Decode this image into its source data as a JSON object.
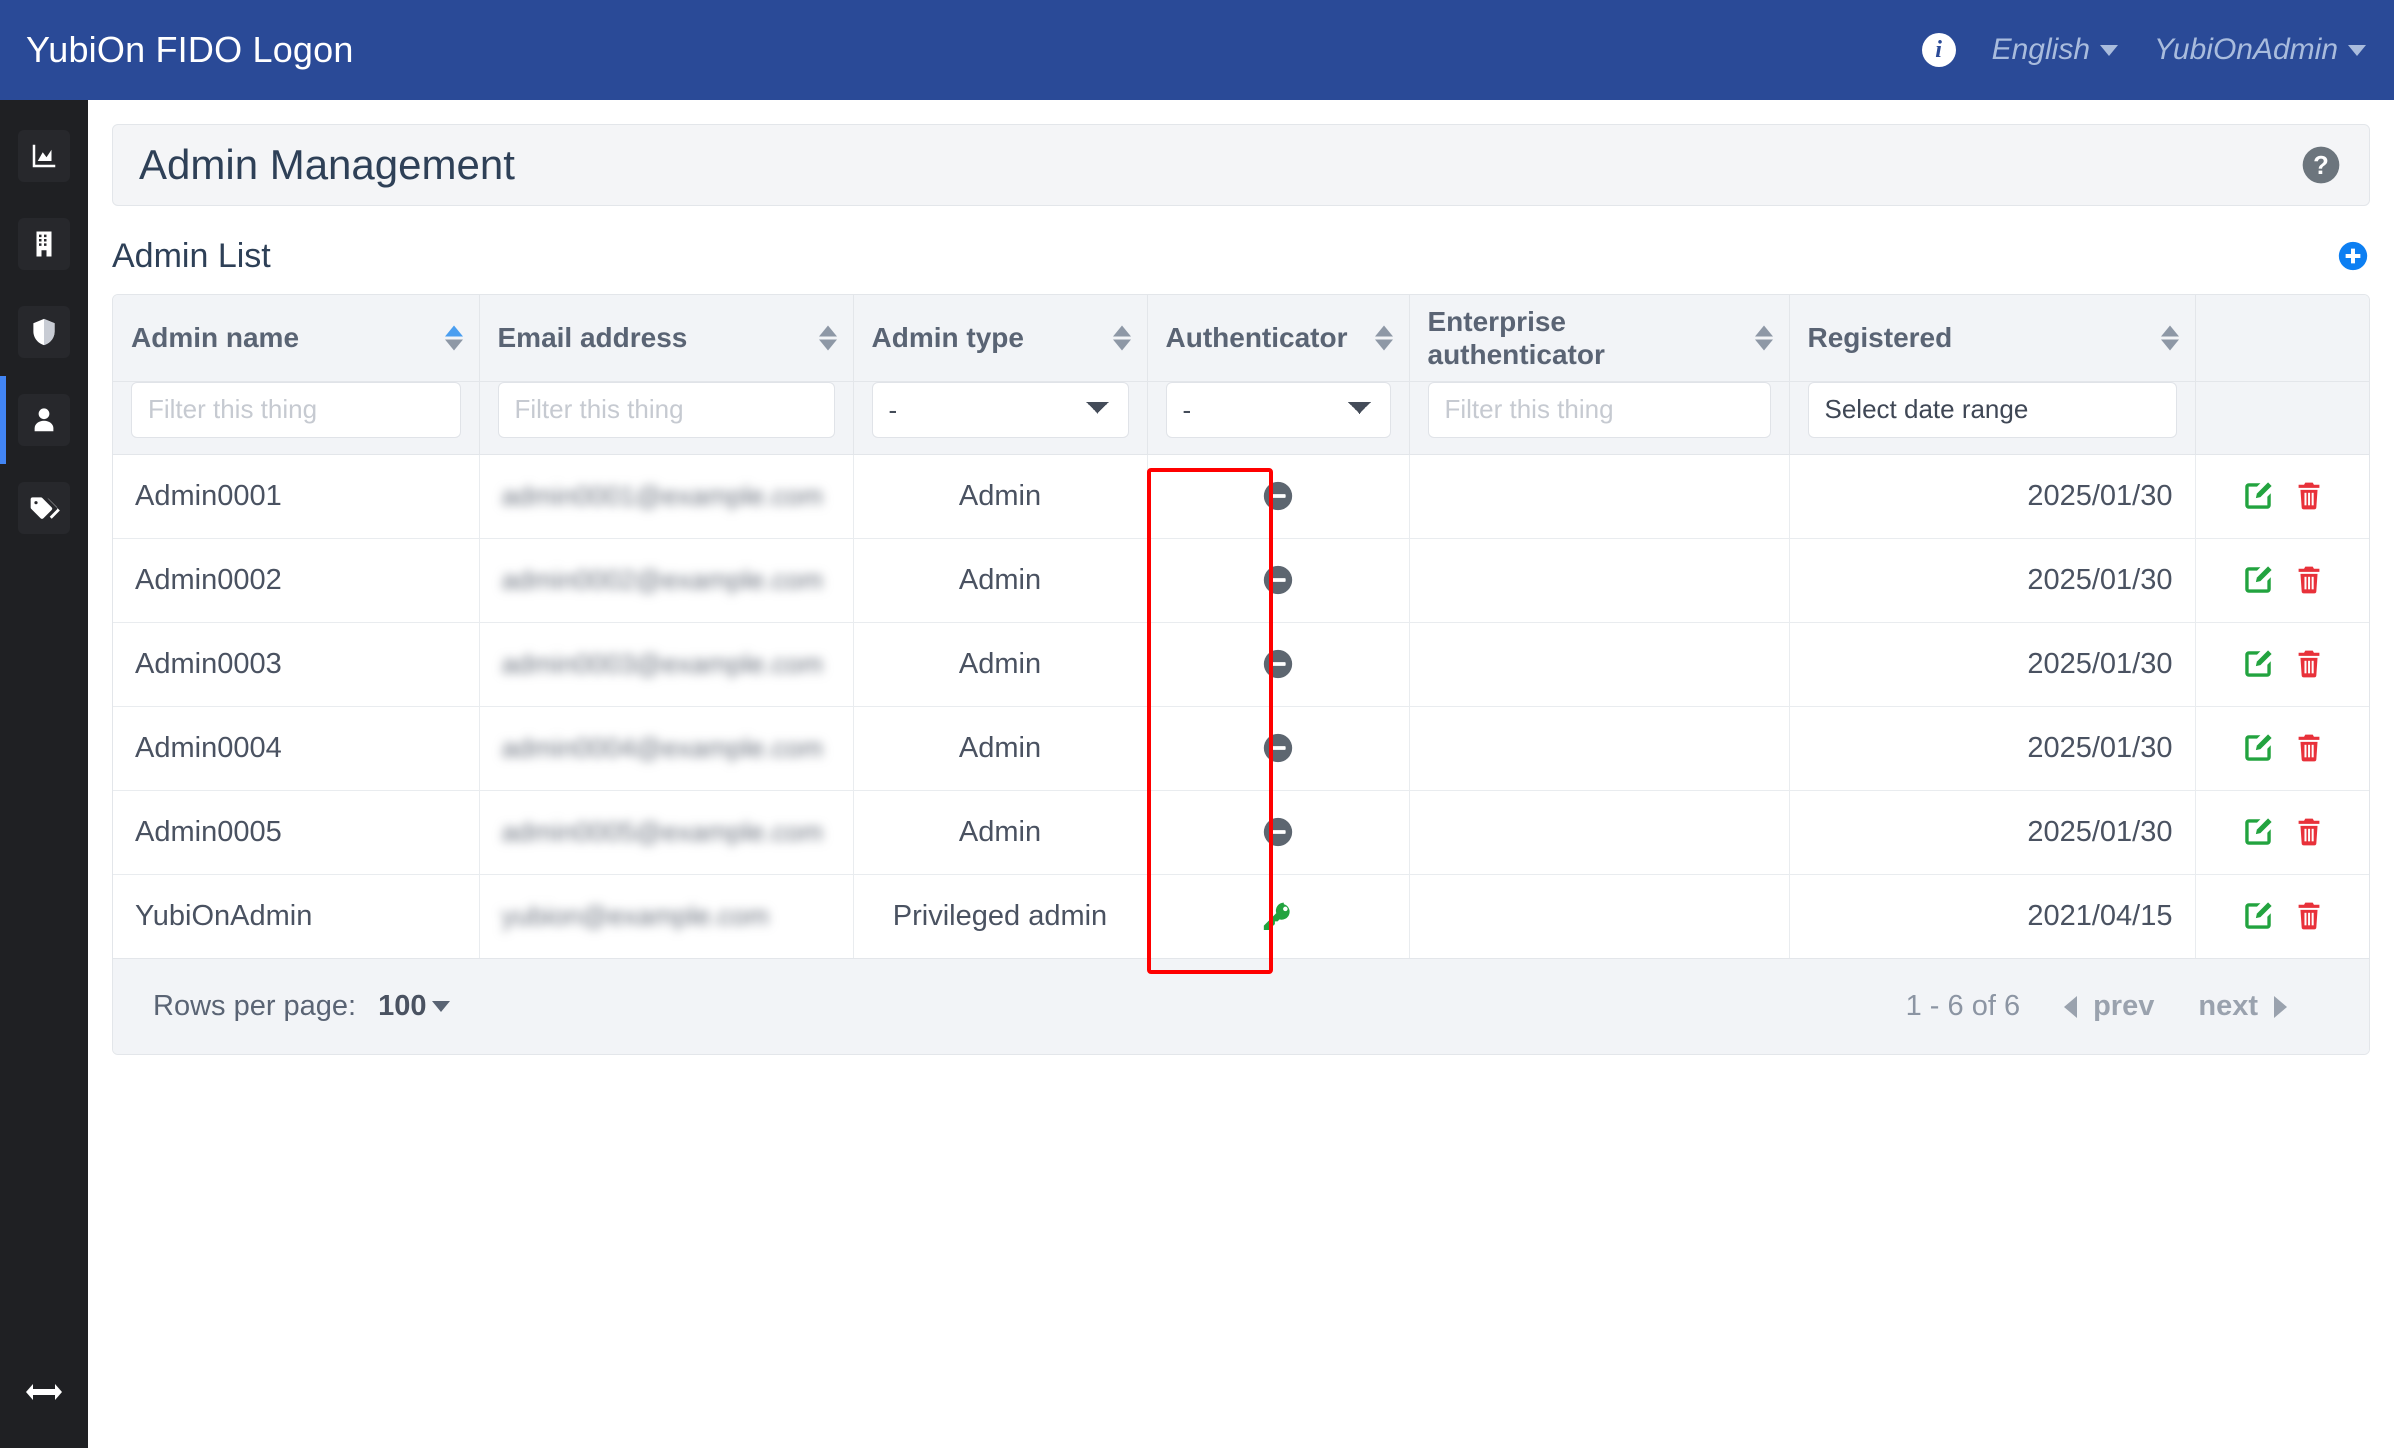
{
  "navbar": {
    "brand": "YubiOn FIDO Logon",
    "info_icon": "info-circle-icon",
    "language": "English",
    "account": "YubiOnAdmin"
  },
  "sidebar": {
    "items": [
      {
        "name": "dashboard",
        "icon": "chart-area-icon",
        "active": false
      },
      {
        "name": "organization",
        "icon": "building-icon",
        "active": false
      },
      {
        "name": "security",
        "icon": "shield-half-icon",
        "active": false
      },
      {
        "name": "admin-management",
        "icon": "user-icon",
        "active": true
      },
      {
        "name": "tags",
        "icon": "tags-icon",
        "active": false
      }
    ],
    "toggle_icon": "arrows-left-right-icon"
  },
  "page": {
    "title": "Admin Management",
    "help_icon": "question-circle-icon",
    "section_title": "Admin List",
    "add_icon": "plus-circle-icon"
  },
  "table": {
    "columns": [
      {
        "label": "Admin name",
        "sortable": true,
        "sort": "asc",
        "align": "left"
      },
      {
        "label": "Email address",
        "sortable": true,
        "sort": "none",
        "align": "left"
      },
      {
        "label": "Admin type",
        "sortable": true,
        "sort": "none",
        "align": "center"
      },
      {
        "label": "Authenticator",
        "sortable": true,
        "sort": "none",
        "align": "center"
      },
      {
        "label": "Enterprise authenticator",
        "sortable": true,
        "sort": "none",
        "align": "center"
      },
      {
        "label": "Registered",
        "sortable": true,
        "sort": "none",
        "align": "right"
      },
      {
        "label": "",
        "sortable": false,
        "sort": "none",
        "align": "center"
      }
    ],
    "filters": {
      "admin_name": {
        "type": "text",
        "value": "",
        "placeholder": "Filter this thing"
      },
      "email": {
        "type": "text",
        "value": "",
        "placeholder": "Filter this thing"
      },
      "admin_type": {
        "type": "select",
        "value": "-",
        "options": [
          "-"
        ]
      },
      "authenticator": {
        "type": "select",
        "value": "-",
        "options": [
          "-"
        ]
      },
      "enterprise_authenticator": {
        "type": "text",
        "value": "",
        "placeholder": "Filter this thing"
      },
      "registered": {
        "type": "daterange",
        "value": "Select date range"
      }
    },
    "rows": [
      {
        "admin_name": "Admin0001",
        "email": "admin0001@example.com",
        "email_redacted": true,
        "admin_type": "Admin",
        "authenticator": "minus-circle-icon",
        "enterprise_authenticator": "",
        "registered": "2025/01/30"
      },
      {
        "admin_name": "Admin0002",
        "email": "admin0002@example.com",
        "email_redacted": true,
        "admin_type": "Admin",
        "authenticator": "minus-circle-icon",
        "enterprise_authenticator": "",
        "registered": "2025/01/30"
      },
      {
        "admin_name": "Admin0003",
        "email": "admin0003@example.com",
        "email_redacted": true,
        "admin_type": "Admin",
        "authenticator": "minus-circle-icon",
        "enterprise_authenticator": "",
        "registered": "2025/01/30"
      },
      {
        "admin_name": "Admin0004",
        "email": "admin0004@example.com",
        "email_redacted": true,
        "admin_type": "Admin",
        "authenticator": "minus-circle-icon",
        "enterprise_authenticator": "",
        "registered": "2025/01/30"
      },
      {
        "admin_name": "Admin0005",
        "email": "admin0005@example.com",
        "email_redacted": true,
        "admin_type": "Admin",
        "authenticator": "minus-circle-icon",
        "enterprise_authenticator": "",
        "registered": "2025/01/30"
      },
      {
        "admin_name": "YubiOnAdmin",
        "email": "yubion@example.com",
        "email_redacted": true,
        "admin_type": "Privileged admin",
        "authenticator": "key-icon",
        "enterprise_authenticator": "",
        "registered": "2021/04/15"
      }
    ],
    "row_actions": {
      "edit_icon": "pen-square-icon",
      "delete_icon": "trash-icon"
    }
  },
  "footer": {
    "rows_per_page_label": "Rows per page:",
    "rows_per_page_value": "100",
    "range": "1 - 6 of 6",
    "prev_label": "prev",
    "next_label": "next"
  },
  "annotation": {
    "type": "highlight-rectangle",
    "target_column": "Authenticator",
    "color": "#ff0000"
  },
  "colors": {
    "navbar": "#2a4a97",
    "sidebar": "#1f2023",
    "accent_blue": "#4285f4",
    "edit_green": "#22a33f",
    "delete_red": "#e8313a",
    "key_green": "#22a33f",
    "annotation_red": "#ff0000"
  }
}
